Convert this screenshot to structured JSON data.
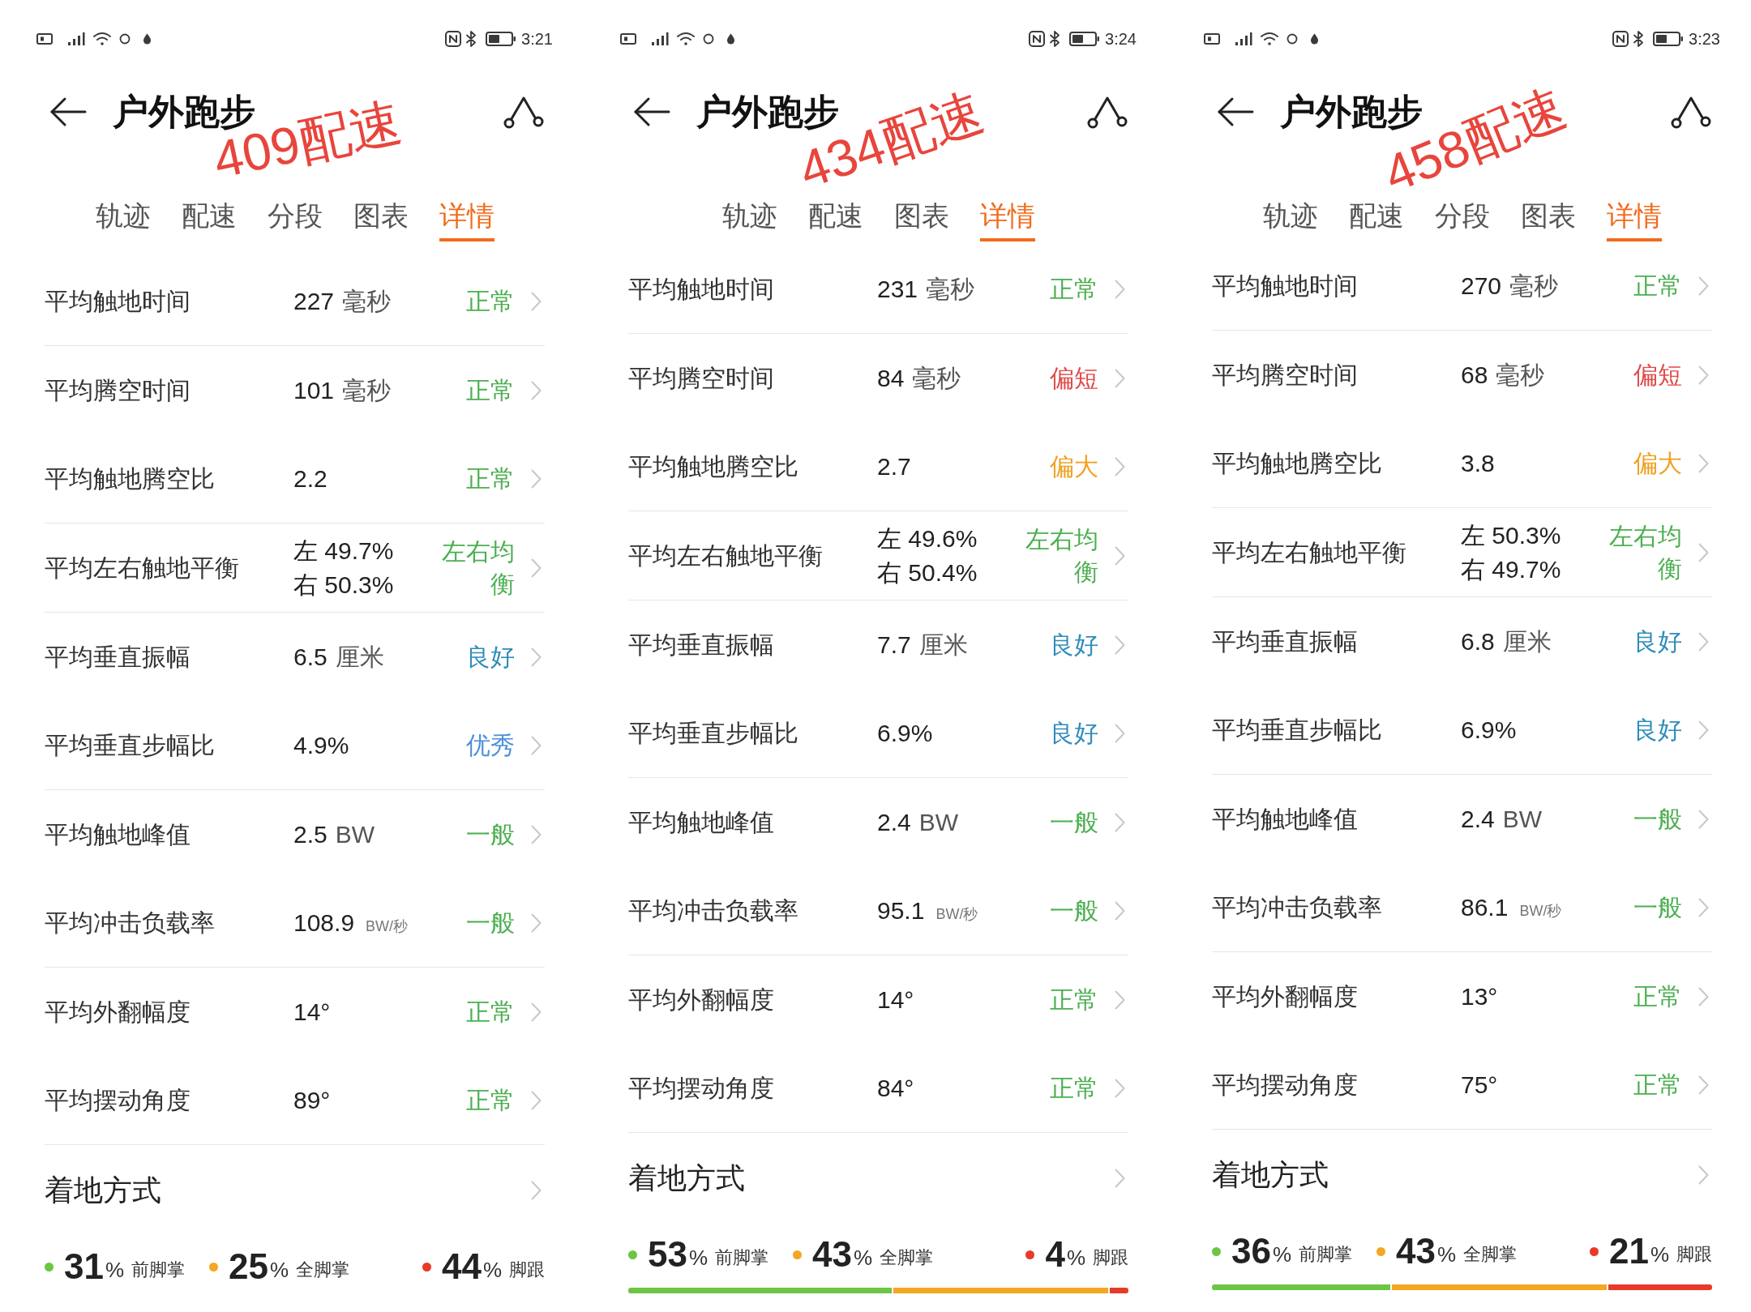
{
  "screens": [
    {
      "status_bar": {
        "time": "3:21"
      },
      "header": {
        "title": "户外跑步"
      },
      "annotation": "409配速",
      "tabs": [
        {
          "label": "轨迹",
          "selected": false
        },
        {
          "label": "配速",
          "selected": false
        },
        {
          "label": "分段",
          "selected": false
        },
        {
          "label": "图表",
          "selected": false
        },
        {
          "label": "详情",
          "selected": true
        }
      ],
      "metric_groups": [
        {
          "metrics": [
            {
              "kind": "single",
              "label": "平均触地时间",
              "value": "227",
              "unit": "毫秒",
              "unit_small": false,
              "status": "正常",
              "color": "#4caf50"
            }
          ]
        },
        {
          "metrics": [
            {
              "kind": "single",
              "label": "平均腾空时间",
              "value": "101",
              "unit": "毫秒",
              "unit_small": false,
              "status": "正常",
              "color": "#4caf50"
            },
            {
              "kind": "single",
              "label": "平均触地腾空比",
              "value": "2.2",
              "status": "正常",
              "color": "#4caf50"
            }
          ]
        },
        {
          "metrics": [
            {
              "kind": "split",
              "label": "平均左右触地平衡",
              "values": [
                "左 49.7%",
                "右 50.3%"
              ],
              "status": "左右均衡",
              "color": "#4caf50"
            }
          ]
        },
        {
          "metrics": [
            {
              "kind": "single",
              "label": "平均垂直振幅",
              "value": "6.5",
              "unit": "厘米",
              "unit_small": false,
              "status": "良好",
              "color": "#2f8cba"
            },
            {
              "kind": "single",
              "label": "平均垂直步幅比",
              "value": "4.9%",
              "status": "优秀",
              "color": "#4a90d9"
            }
          ]
        },
        {
          "metrics": [
            {
              "kind": "single",
              "label": "平均触地峰值",
              "value": "2.5",
              "unit": "BW",
              "unit_small": false,
              "status": "一般",
              "color": "#4caf50"
            },
            {
              "kind": "single",
              "label": "平均冲击负载率",
              "value": "108.9",
              "unit": "BW/秒",
              "unit_small": true,
              "status": "一般",
              "color": "#4caf50"
            }
          ]
        },
        {
          "metrics": [
            {
              "kind": "single",
              "label": "平均外翻幅度",
              "value": "14°",
              "status": "正常",
              "color": "#4caf50"
            },
            {
              "kind": "single",
              "label": "平均摆动角度",
              "value": "89°",
              "status": "正常",
              "color": "#4caf50"
            }
          ]
        }
      ],
      "strike_pattern": {
        "title": "着地方式",
        "items": [
          {
            "value": "31",
            "unit": "%",
            "label": "前脚掌",
            "color": "#6cc644"
          },
          {
            "value": "25",
            "unit": "%",
            "label": "全脚掌",
            "color": "#f5a623"
          },
          {
            "value": "44",
            "unit": "%",
            "label": "脚跟",
            "color": "#e8392a"
          }
        ]
      }
    },
    {
      "status_bar": {
        "time": "3:24"
      },
      "header": {
        "title": "户外跑步"
      },
      "annotation": "434配速",
      "tabs": [
        {
          "label": "轨迹",
          "selected": false
        },
        {
          "label": "配速",
          "selected": false
        },
        {
          "label": "图表",
          "selected": false
        },
        {
          "label": "详情",
          "selected": true
        }
      ],
      "metric_groups": [
        {
          "metrics": [
            {
              "kind": "single",
              "label": "平均触地时间",
              "value": "231",
              "unit": "毫秒",
              "unit_small": false,
              "status": "正常",
              "color": "#4caf50"
            }
          ]
        },
        {
          "metrics": [
            {
              "kind": "single",
              "label": "平均腾空时间",
              "value": "84",
              "unit": "毫秒",
              "unit_small": false,
              "status": "偏短",
              "color": "#e04b4b"
            },
            {
              "kind": "single",
              "label": "平均触地腾空比",
              "value": "2.7",
              "status": "偏大",
              "color": "#f0a020"
            }
          ]
        },
        {
          "metrics": [
            {
              "kind": "split",
              "label": "平均左右触地平衡",
              "values": [
                "左 49.6%",
                "右 50.4%"
              ],
              "status": "左右均衡",
              "color": "#4caf50"
            }
          ]
        },
        {
          "metrics": [
            {
              "kind": "single",
              "label": "平均垂直振幅",
              "value": "7.7",
              "unit": "厘米",
              "unit_small": false,
              "status": "良好",
              "color": "#2f8cba"
            },
            {
              "kind": "single",
              "label": "平均垂直步幅比",
              "value": "6.9%",
              "status": "良好",
              "color": "#2f8cba"
            }
          ]
        },
        {
          "metrics": [
            {
              "kind": "single",
              "label": "平均触地峰值",
              "value": "2.4",
              "unit": "BW",
              "unit_small": false,
              "status": "一般",
              "color": "#4caf50"
            },
            {
              "kind": "single",
              "label": "平均冲击负载率",
              "value": "95.1",
              "unit": "BW/秒",
              "unit_small": true,
              "status": "一般",
              "color": "#4caf50"
            }
          ]
        },
        {
          "metrics": [
            {
              "kind": "single",
              "label": "平均外翻幅度",
              "value": "14°",
              "status": "正常",
              "color": "#4caf50"
            },
            {
              "kind": "single",
              "label": "平均摆动角度",
              "value": "84°",
              "status": "正常",
              "color": "#4caf50"
            }
          ]
        }
      ],
      "strike_pattern": {
        "title": "着地方式",
        "items": [
          {
            "value": "53",
            "unit": "%",
            "label": "前脚掌",
            "color": "#6cc644",
            "level": 0.53
          },
          {
            "value": "43",
            "unit": "%",
            "label": "全脚掌",
            "color": "#f5a623"
          },
          {
            "value": "4",
            "unit": "%",
            "label": "脚跟",
            "color": "#e8392a",
            "level": 0.04
          }
        ]
      }
    },
    {
      "status_bar": {
        "time": "3:23"
      },
      "header": {
        "title": "户外跑步"
      },
      "annotation": "458配速",
      "tabs": [
        {
          "label": "轨迹",
          "selected": false
        },
        {
          "label": "配速",
          "selected": false
        },
        {
          "label": "分段",
          "selected": false
        },
        {
          "label": "图表",
          "selected": false
        },
        {
          "label": "详情",
          "selected": true
        }
      ],
      "metric_groups": [
        {
          "metrics": [
            {
              "kind": "single",
              "label": "平均触地时间",
              "value": "270",
              "unit": "毫秒",
              "unit_small": false,
              "status": "正常",
              "color": "#4caf50"
            }
          ]
        },
        {
          "metrics": [
            {
              "kind": "single",
              "label": "平均腾空时间",
              "value": "68",
              "unit": "毫秒",
              "unit_small": false,
              "status": "偏短",
              "color": "#e04b4b"
            },
            {
              "kind": "single",
              "label": "平均触地腾空比",
              "value": "3.8",
              "status": "偏大",
              "color": "#f0a020"
            }
          ]
        },
        {
          "metrics": [
            {
              "kind": "split",
              "label": "平均左右触地平衡",
              "values": [
                "左 50.3%",
                "右 49.7%"
              ],
              "status": "左右均衡",
              "color": "#4caf50"
            }
          ]
        },
        {
          "metrics": [
            {
              "kind": "single",
              "label": "平均垂直振幅",
              "value": "6.8",
              "unit": "厘米",
              "unit_small": false,
              "status": "良好",
              "color": "#2f8cba"
            },
            {
              "kind": "single",
              "label": "平均垂直步幅比",
              "value": "6.9%",
              "status": "良好",
              "color": "#2f8cba"
            }
          ]
        },
        {
          "metrics": [
            {
              "kind": "single",
              "label": "平均触地峰值",
              "value": "2.4",
              "unit": "BW",
              "unit_small": false,
              "status": "一般",
              "color": "#4caf50"
            },
            {
              "kind": "single",
              "label": "平均冲击负载率",
              "value": "86.1",
              "unit": "BW/秒",
              "unit_small": true,
              "status": "一般",
              "color": "#4caf50"
            }
          ]
        },
        {
          "metrics": [
            {
              "kind": "single",
              "label": "平均外翻幅度",
              "value": "13°",
              "status": "正常",
              "color": "#4caf50"
            },
            {
              "kind": "single",
              "label": "平均摆动角度",
              "value": "75°",
              "status": "正常",
              "color": "#4caf50"
            }
          ]
        }
      ],
      "strike_pattern": {
        "title": "着地方式",
        "items": [
          {
            "value": "36",
            "unit": "%",
            "label": "前脚掌",
            "color": "#6cc644",
            "level": 0.36
          },
          {
            "value": "43",
            "unit": "%",
            "label": "全脚掌",
            "color": "#f5a623"
          },
          {
            "value": "21",
            "unit": "%",
            "label": "脚跟",
            "color": "#e8392a",
            "level": 0.21
          }
        ]
      }
    }
  ]
}
